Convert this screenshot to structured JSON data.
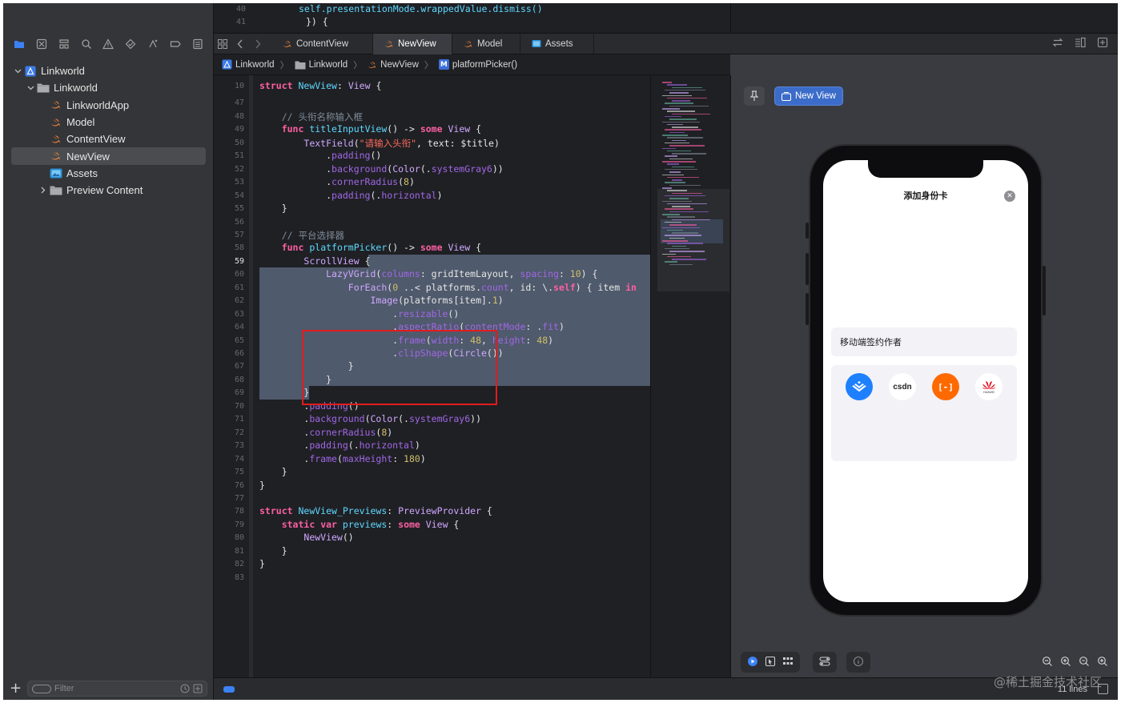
{
  "navigator": {
    "tree": [
      {
        "label": "Linkworld",
        "level": 0,
        "icon": "project-icon",
        "disclosure": "open"
      },
      {
        "label": "Linkworld",
        "level": 1,
        "icon": "folder-icon",
        "disclosure": "open"
      },
      {
        "label": "LinkworldApp",
        "level": 2,
        "icon": "swift-file-icon"
      },
      {
        "label": "Model",
        "level": 2,
        "icon": "swift-file-icon"
      },
      {
        "label": "ContentView",
        "level": 2,
        "icon": "swift-file-icon"
      },
      {
        "label": "NewView",
        "level": 2,
        "icon": "swift-file-icon",
        "selected": true
      },
      {
        "label": "Assets",
        "level": 2,
        "icon": "assets-icon"
      },
      {
        "label": "Preview Content",
        "level": 2,
        "icon": "folder-icon",
        "disclosure": "closed"
      }
    ],
    "filter_placeholder": "Filter"
  },
  "top_strip": {
    "lines": [
      {
        "no": "40",
        "code": "self.presentationMode.wrappedValue.dismiss()"
      },
      {
        "no": "41",
        "code": "}) {"
      }
    ]
  },
  "tabs": [
    {
      "label": "ContentView",
      "icon": "swift-file-icon",
      "active": false
    },
    {
      "label": "NewView",
      "icon": "swift-file-icon",
      "active": true
    },
    {
      "label": "Model",
      "icon": "swift-file-icon",
      "active": false
    },
    {
      "label": "Assets",
      "icon": "assets-icon",
      "active": false
    }
  ],
  "breadcrumb": [
    "Linkworld",
    "Linkworld",
    "NewView",
    "platformPicker()"
  ],
  "editor": {
    "sticky_line": "10",
    "lines": [
      {
        "no": "10",
        "text": "struct NewView: View {"
      },
      {
        "no": "47",
        "text": ""
      },
      {
        "no": "48",
        "text": "    // 头衔名称输入框"
      },
      {
        "no": "49",
        "text": "    func titleInputView() -> some View {"
      },
      {
        "no": "50",
        "text": "        TextField(\"请输入头衔\", text: $title)"
      },
      {
        "no": "51",
        "text": "            .padding()"
      },
      {
        "no": "52",
        "text": "            .background(Color(.systemGray6))"
      },
      {
        "no": "53",
        "text": "            .cornerRadius(8)"
      },
      {
        "no": "54",
        "text": "            .padding(.horizontal)"
      },
      {
        "no": "55",
        "text": "    }"
      },
      {
        "no": "56",
        "text": ""
      },
      {
        "no": "57",
        "text": "    // 平台选择器"
      },
      {
        "no": "58",
        "text": "    func platformPicker() -> some View {"
      },
      {
        "no": "59",
        "text": "        ScrollView {"
      },
      {
        "no": "60",
        "text": "            LazyVGrid(columns: gridItemLayout, spacing: 10) {"
      },
      {
        "no": "61",
        "text": "                ForEach(0 ..< platforms.count, id: \\.self) { item in"
      },
      {
        "no": "62",
        "text": "                    Image(platforms[item].1)"
      },
      {
        "no": "63",
        "text": "                        .resizable()"
      },
      {
        "no": "64",
        "text": "                        .aspectRatio(contentMode: .fit)"
      },
      {
        "no": "65",
        "text": "                        .frame(width: 48, height: 48)"
      },
      {
        "no": "66",
        "text": "                        .clipShape(Circle())"
      },
      {
        "no": "67",
        "text": "                }"
      },
      {
        "no": "68",
        "text": "            }"
      },
      {
        "no": "69",
        "text": "        }"
      },
      {
        "no": "70",
        "text": "        .padding()"
      },
      {
        "no": "71",
        "text": "        .background(Color(.systemGray6))"
      },
      {
        "no": "72",
        "text": "        .cornerRadius(8)"
      },
      {
        "no": "73",
        "text": "        .padding(.horizontal)"
      },
      {
        "no": "74",
        "text": "        .frame(maxHeight: 180)"
      },
      {
        "no": "75",
        "text": "    }"
      },
      {
        "no": "76",
        "text": "}"
      },
      {
        "no": "77",
        "text": ""
      },
      {
        "no": "78",
        "text": "struct NewView_Previews: PreviewProvider {"
      },
      {
        "no": "79",
        "text": "    static var previews: some View {"
      },
      {
        "no": "80",
        "text": "        NewView()"
      },
      {
        "no": "81",
        "text": "    }"
      },
      {
        "no": "82",
        "text": "}"
      },
      {
        "no": "83",
        "text": ""
      }
    ],
    "current_line": "59"
  },
  "canvas": {
    "preview_label": "New View",
    "phone": {
      "sheet_title": "添加身份卡",
      "title_field_text": "移动端签约作者",
      "platforms": [
        {
          "name": "juejin",
          "icon": "juejin-logo-icon",
          "color": "#1e80ff"
        },
        {
          "name": "csdn",
          "label": "csdn",
          "icon": "csdn-logo-icon",
          "color": "#fc5531"
        },
        {
          "name": "aliyun",
          "label": "[-]",
          "icon": "aliyun-logo-icon",
          "color": "#ff6a00"
        },
        {
          "name": "huawei",
          "label": "HUAWEI",
          "icon": "huawei-logo-icon",
          "color": "#e60012"
        }
      ]
    }
  },
  "status": {
    "lines_count": "11 lines",
    "watermark": "@稀土掘金技术社区"
  },
  "colors": {
    "keyword": "#fc5fa3",
    "type": "#d0a8ff",
    "function": "#67b7a4",
    "string": "#fc6a5d",
    "number": "#d0bf69",
    "comment": "#7f8c98",
    "selection": "#4f5a6c",
    "annotation_red": "#e11c1c",
    "accent": "#3c6cc9"
  }
}
